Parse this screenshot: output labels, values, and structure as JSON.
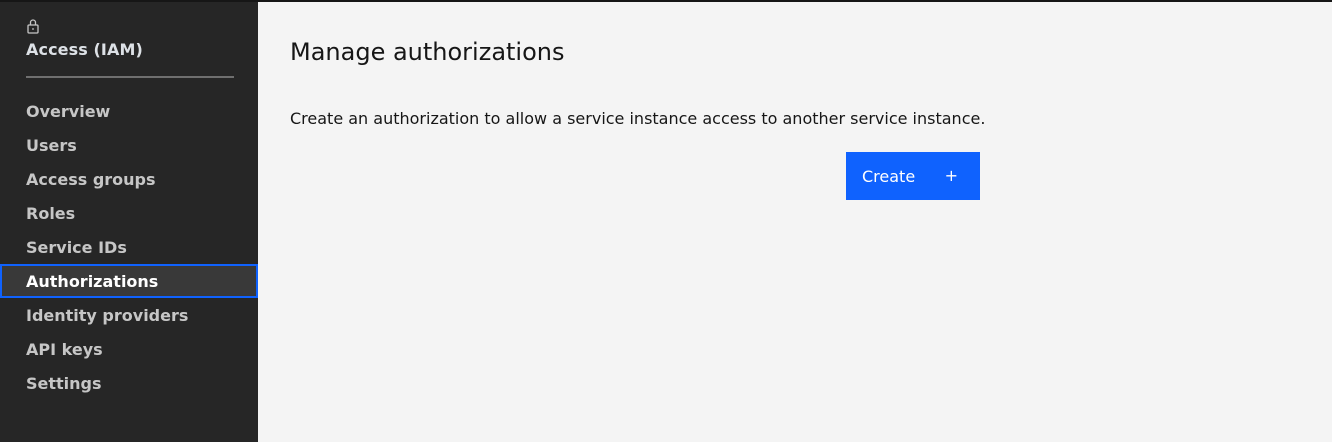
{
  "sidebar": {
    "icon": "lock-icon",
    "title": "Access (IAM)",
    "items": [
      {
        "label": "Overview"
      },
      {
        "label": "Users"
      },
      {
        "label": "Access groups"
      },
      {
        "label": "Roles"
      },
      {
        "label": "Service IDs"
      },
      {
        "label": "Authorizations",
        "active": true
      },
      {
        "label": "Identity providers"
      },
      {
        "label": "API keys"
      },
      {
        "label": "Settings"
      }
    ]
  },
  "main": {
    "title": "Manage authorizations",
    "description": "Create an authorization to allow a service instance access to another service instance.",
    "create_button": {
      "label": "Create",
      "icon": "plus-icon",
      "icon_glyph": "+"
    }
  },
  "colors": {
    "sidebar_bg": "#262626",
    "main_bg": "#f4f4f4",
    "accent": "#0f62fe",
    "active_item_bg": "#393939"
  }
}
